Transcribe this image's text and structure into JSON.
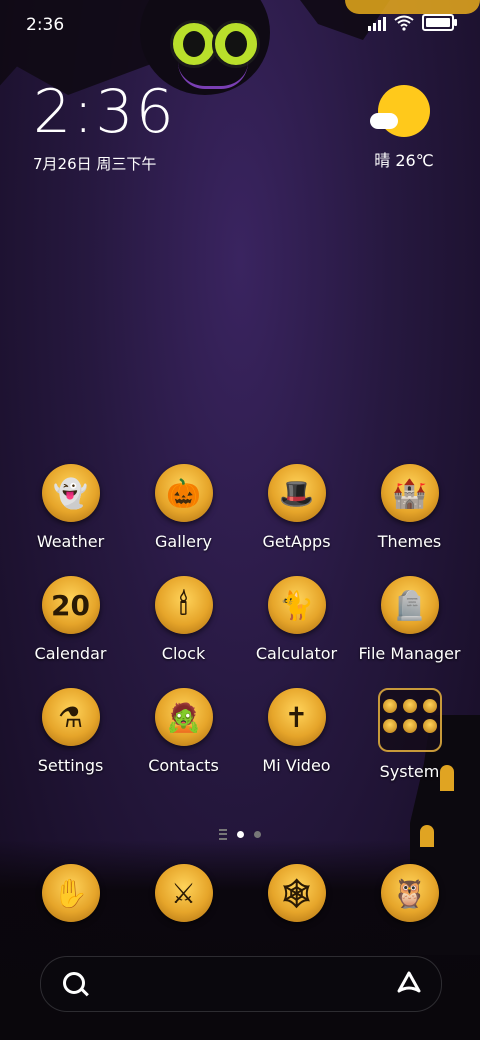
{
  "statusbar": {
    "time": "2:36"
  },
  "clock": {
    "time": "2:36",
    "date": "7月26日 周三下午"
  },
  "weather": {
    "text": "晴 26℃"
  },
  "apps": [
    {
      "label": "Weather",
      "icon": "ghost-icon",
      "glyph": "👻"
    },
    {
      "label": "Gallery",
      "icon": "pumpkin-icon",
      "glyph": "🎃"
    },
    {
      "label": "GetApps",
      "icon": "witch-hat-icon",
      "glyph": "🎩"
    },
    {
      "label": "Themes",
      "icon": "castle-icon",
      "glyph": "🏰"
    },
    {
      "label": "Calendar",
      "icon": "calendar-icon",
      "glyph": "20"
    },
    {
      "label": "Clock",
      "icon": "chandelier-icon",
      "glyph": "🕯"
    },
    {
      "label": "Calculator",
      "icon": "cat-icon",
      "glyph": "🐈"
    },
    {
      "label": "File Manager",
      "icon": "tombstone-icon",
      "glyph": "🪦"
    },
    {
      "label": "Settings",
      "icon": "cauldron-icon",
      "glyph": "⚗"
    },
    {
      "label": "Contacts",
      "icon": "zombie-icon",
      "glyph": "🧟"
    },
    {
      "label": "Mi Video",
      "icon": "grave-cross-icon",
      "glyph": "✝"
    },
    {
      "label": "System",
      "icon": "folder-icon",
      "glyph": ""
    }
  ],
  "dock": [
    {
      "icon": "zombie-hand-icon",
      "glyph": "✋"
    },
    {
      "icon": "claw-marks-icon",
      "glyph": "⚔"
    },
    {
      "icon": "spider-web-icon",
      "glyph": "🕸"
    },
    {
      "icon": "owl-icon",
      "glyph": "🦉"
    }
  ]
}
